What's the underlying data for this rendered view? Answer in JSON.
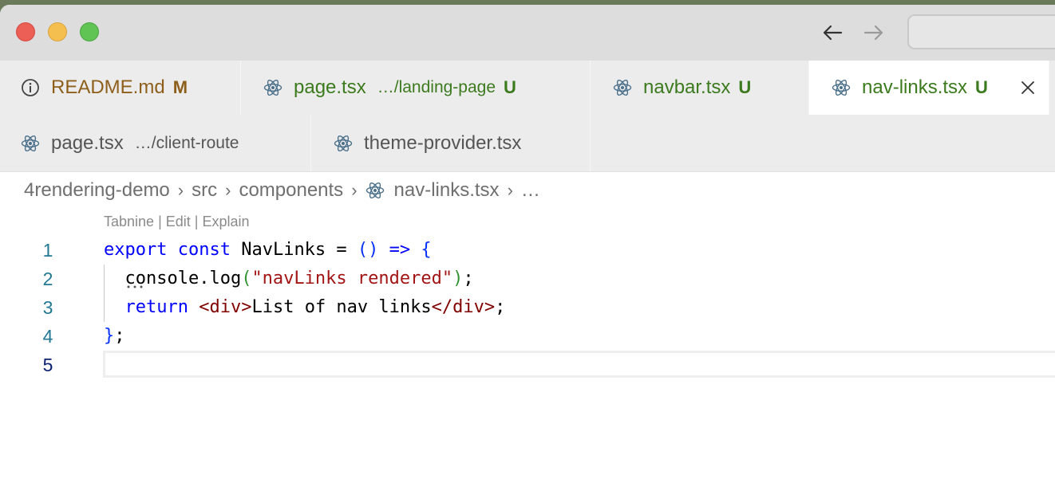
{
  "window": {
    "controls": [
      "close",
      "minimize",
      "maximize"
    ],
    "nav": {
      "back_icon": "arrow-left-icon",
      "forward_icon": "arrow-right-icon"
    }
  },
  "tabs_row1": [
    {
      "name": "README.md",
      "dir": "",
      "status": "M",
      "icon": "info-icon",
      "color": "#8d5f1a"
    },
    {
      "name": "page.tsx",
      "dir": "…/landing-page",
      "status": "U",
      "icon": "react-icon",
      "color": "#3c7a1e"
    },
    {
      "name": "navbar.tsx",
      "dir": "",
      "status": "U",
      "icon": "react-icon",
      "color": "#3c7a1e"
    },
    {
      "name": "nav-links.tsx",
      "dir": "",
      "status": "U",
      "icon": "react-icon",
      "color": "#3c7a1e",
      "active": true
    }
  ],
  "tabs_row2": [
    {
      "name": "page.tsx",
      "dir": "…/client-route",
      "status": "",
      "icon": "react-icon"
    },
    {
      "name": "theme-provider.tsx",
      "dir": "",
      "status": "",
      "icon": "react-icon"
    }
  ],
  "breadcrumb": [
    "4rendering-demo",
    "src",
    "components",
    "nav-links.tsx",
    "…"
  ],
  "codelens": {
    "tabnine": "Tabnine",
    "sep1": " | ",
    "edit": "Edit",
    "sep2": " | ",
    "explain": "Explain"
  },
  "editor": {
    "line_numbers": [
      "1",
      "2",
      "3",
      "4",
      "5"
    ],
    "current_line": 5,
    "lines": [
      [
        {
          "t": "export",
          "c": "kw"
        },
        {
          "t": " ",
          "c": "id"
        },
        {
          "t": "const",
          "c": "kw"
        },
        {
          "t": " NavLinks = ",
          "c": "id"
        },
        {
          "t": "()",
          "c": "brk"
        },
        {
          "t": " ",
          "c": "id"
        },
        {
          "t": "=>",
          "c": "kw"
        },
        {
          "t": " ",
          "c": "id"
        },
        {
          "t": "{",
          "c": "brk"
        }
      ],
      [
        {
          "t": "  console.log",
          "c": "id"
        },
        {
          "t": "(",
          "c": "brk2"
        },
        {
          "t": "\"navLinks rendered\"",
          "c": "str"
        },
        {
          "t": ")",
          "c": "brk2"
        },
        {
          "t": ";",
          "c": "id"
        }
      ],
      [
        {
          "t": "  ",
          "c": "id"
        },
        {
          "t": "return",
          "c": "kw"
        },
        {
          "t": " ",
          "c": "id"
        },
        {
          "t": "<div>",
          "c": "tag"
        },
        {
          "t": "List of nav links",
          "c": "id"
        },
        {
          "t": "</div>",
          "c": "tag"
        },
        {
          "t": ";",
          "c": "id"
        }
      ],
      [
        {
          "t": "}",
          "c": "brk"
        },
        {
          "t": ";",
          "c": "id"
        }
      ],
      [
        {
          "t": "",
          "c": "id"
        }
      ]
    ]
  }
}
